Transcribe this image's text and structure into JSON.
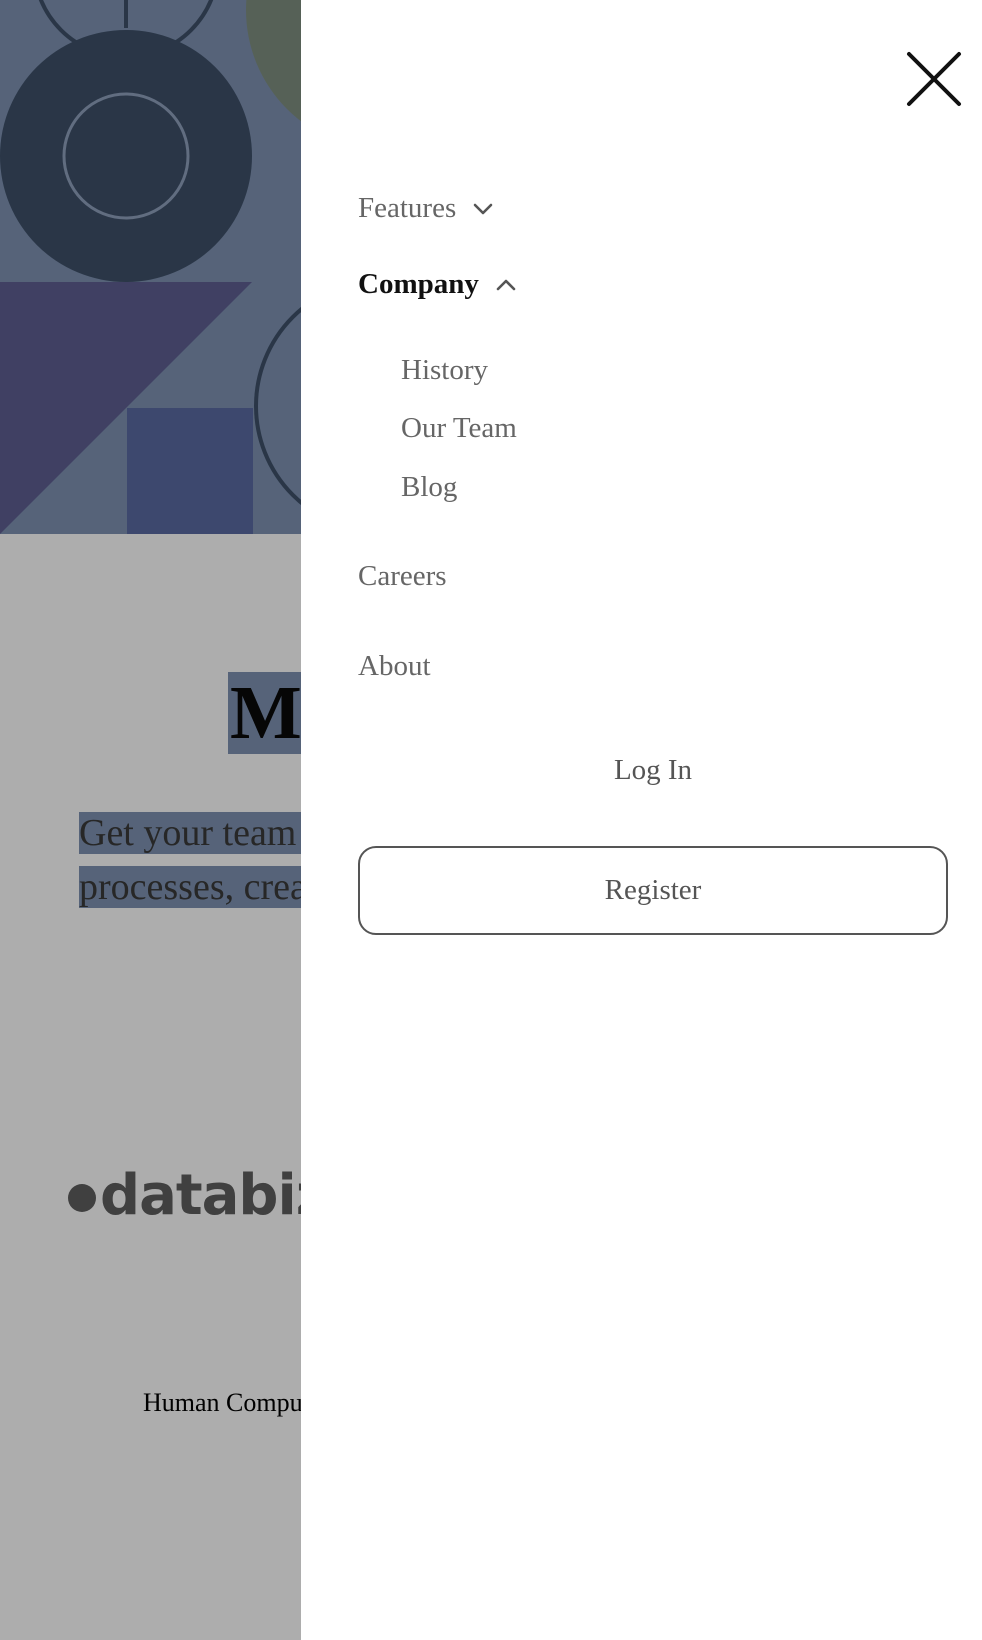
{
  "page": {
    "hero_title": "Ma",
    "hero_subtitle_line1": "Get your team i",
    "hero_subtitle_line2": "processes, creat",
    "logo_text": "databiz",
    "logo_icon": "dot-icon",
    "footer_text": "Human Compu"
  },
  "menu": {
    "close_icon": "close-icon",
    "items": [
      {
        "label": "Features",
        "icon": "chevron-down-icon",
        "expanded": false
      },
      {
        "label": "Company",
        "icon": "chevron-up-icon",
        "expanded": true,
        "subitems": [
          {
            "label": "History"
          },
          {
            "label": "Our Team"
          },
          {
            "label": "Blog"
          }
        ]
      },
      {
        "label": "Careers"
      },
      {
        "label": "About"
      }
    ],
    "login_label": "Log In",
    "register_label": "Register"
  },
  "colors": {
    "overlay": "#000000",
    "hero_bg": "#7f93b3",
    "highlight": "#7f93b3",
    "dark_navy": "#3e5069",
    "purple": "#5f5f93",
    "blue_square": "#5a6aa3",
    "olive_circle": "#7f9080",
    "text_active": "#111111",
    "text_muted": "#666666"
  }
}
